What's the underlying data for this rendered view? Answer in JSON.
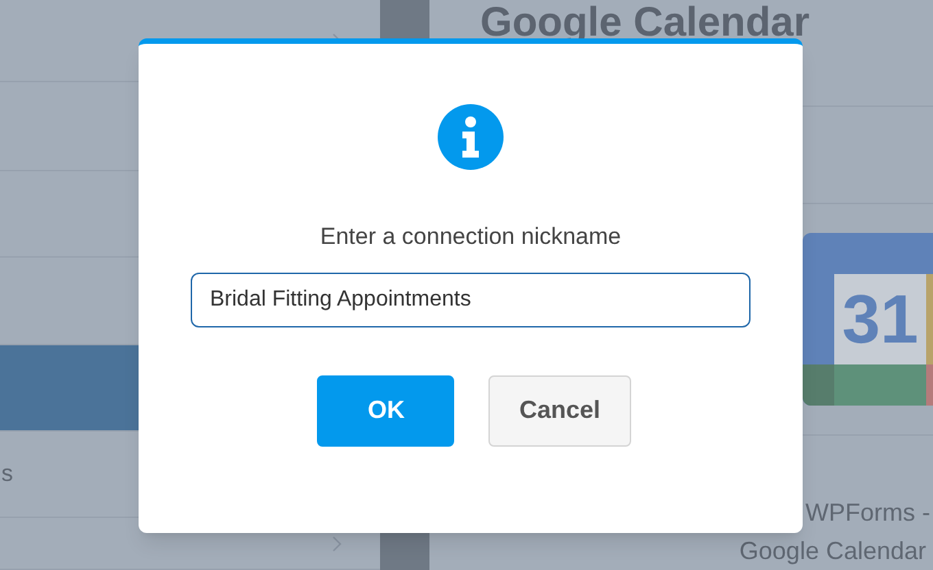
{
  "sidebar": {
    "items": [
      {
        "selected": false
      },
      {
        "selected": false
      },
      {
        "selected": false
      },
      {
        "selected": false
      },
      {
        "selected": true
      },
      {
        "label": "s",
        "selected": false
      },
      {
        "selected": false
      }
    ]
  },
  "main": {
    "heading": "Google Calendar",
    "logo_text": "31",
    "caption_lines": [
      "WPForms -",
      "Google Calendar"
    ]
  },
  "dialog": {
    "message": "Enter a connection nickname",
    "input_value": "Bridal Fitting Appointments",
    "buttons": [
      {
        "label": "OK",
        "kind": "primary"
      },
      {
        "label": "Cancel",
        "kind": "secondary"
      }
    ]
  }
}
